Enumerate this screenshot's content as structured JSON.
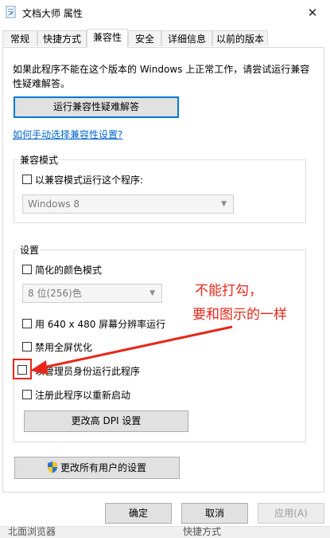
{
  "window": {
    "title": "文档大师 属性",
    "close_glyph": "✕"
  },
  "tabs": [
    {
      "label": "常规",
      "active": false
    },
    {
      "label": "快捷方式",
      "active": false
    },
    {
      "label": "兼容性",
      "active": true
    },
    {
      "label": "安全",
      "active": false
    },
    {
      "label": "详细信息",
      "active": false
    },
    {
      "label": "以前的版本",
      "active": false
    }
  ],
  "intro_text": "如果此程序不能在这个版本的 Windows 上正常工作，请尝试运行兼容性疑难解答。",
  "troubleshoot_button": "运行兼容性疑难解答",
  "manual_link": "如何手动选择兼容性设置?",
  "compat_mode": {
    "group_label": "兼容模式",
    "checkbox_label": "以兼容模式运行这个程序:",
    "checked": false,
    "select_value": "Windows 8"
  },
  "settings": {
    "group_label": "设置",
    "reduced_color": {
      "label": "简化的颜色模式",
      "checked": false
    },
    "color_select_value": "8 位(256)色",
    "res_640": {
      "label": "用 640 x 480 屏幕分辨率运行",
      "checked": false
    },
    "disable_fullscreen": {
      "label": "禁用全屏优化",
      "checked": false
    },
    "run_as_admin": {
      "label": "以管理员身份运行此程序",
      "checked": false
    },
    "register_restart": {
      "label": "注册此程序以重新启动",
      "checked": false
    },
    "dpi_button": "更改高 DPI 设置"
  },
  "all_users_button": "更改所有用户的设置",
  "dialog_buttons": {
    "ok": "确定",
    "cancel": "取消",
    "apply": "应用(A)"
  },
  "annotation": {
    "line1": "不能打勾，",
    "line2": "要和图示的一样"
  },
  "taskbar_left": "北面浏览器",
  "taskbar_right": "快捷方式",
  "colors": {
    "accent": "#0078d7",
    "annotation_red": "#e8261a",
    "link": "#0066cc"
  },
  "icons": [
    "app-icon",
    "shield-icon",
    "chevron-down-icon",
    "close-icon",
    "arrow-annotation-icon"
  ]
}
